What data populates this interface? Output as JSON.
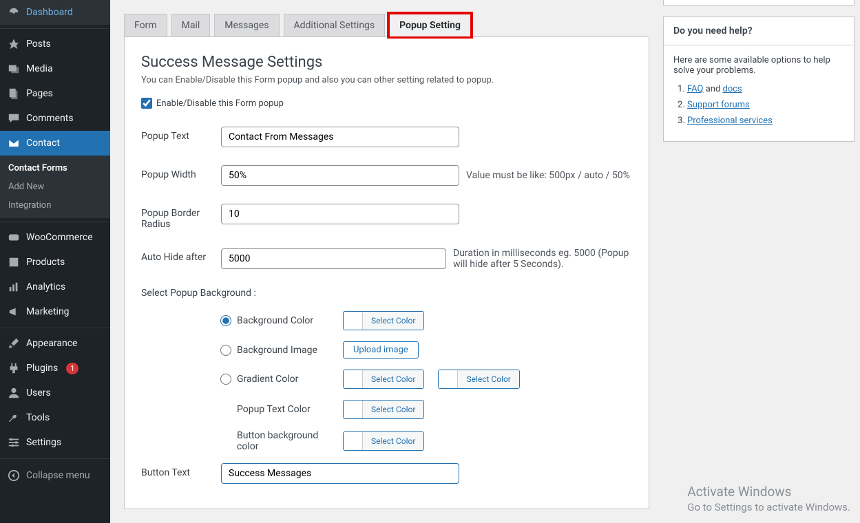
{
  "sidebar": {
    "dashboard": "Dashboard",
    "posts": "Posts",
    "media": "Media",
    "pages": "Pages",
    "comments": "Comments",
    "contact": "Contact",
    "contact_sub": {
      "forms": "Contact Forms",
      "add": "Add New",
      "integration": "Integration"
    },
    "woo": "WooCommerce",
    "products": "Products",
    "analytics": "Analytics",
    "marketing": "Marketing",
    "appearance": "Appearance",
    "plugins": "Plugins",
    "plugins_badge": "1",
    "users": "Users",
    "tools": "Tools",
    "settings": "Settings",
    "collapse": "Collapse menu"
  },
  "tabs": {
    "form": "Form",
    "mail": "Mail",
    "messages": "Messages",
    "additional": "Additional Settings",
    "popup": "Popup Setting"
  },
  "panel": {
    "title": "Success Message Settings",
    "desc": "You can Enable/Disable this Form popup and also you can other setting related to popup.",
    "chk_label": "Enable/Disable this Form popup",
    "popup_text": {
      "label": "Popup Text",
      "value": "Contact From Messages"
    },
    "popup_width": {
      "label": "Popup Width",
      "value": "50%",
      "hint": "Value must be like: 500px / auto / 50%"
    },
    "popup_radius": {
      "label": "Popup Border Radius",
      "value": "10"
    },
    "auto_hide": {
      "label": "Auto Hide after",
      "value": "5000",
      "hint": "Duration in milliseconds eg. 5000 (Popup will hide after 5 Seconds)."
    },
    "bg_label": "Select Popup Background :",
    "bg": {
      "color": "Background Color",
      "image": "Background Image",
      "gradient": "Gradient Color",
      "text_color": "Popup Text Color",
      "btn_bg": "Button background color",
      "select_color": "Select Color",
      "upload": "Upload image"
    },
    "button_text": {
      "label": "Button Text",
      "value": "Success Messages"
    }
  },
  "help": {
    "title": "Do you need help?",
    "intro": "Here are some available options to help solve your problems.",
    "faq_pre": "FAQ",
    "faq_mid": " and ",
    "faq_post": "docs",
    "forums": "Support forums",
    "pro": "Professional services"
  },
  "watermark": {
    "title": "Activate Windows",
    "sub": "Go to Settings to activate Windows."
  }
}
